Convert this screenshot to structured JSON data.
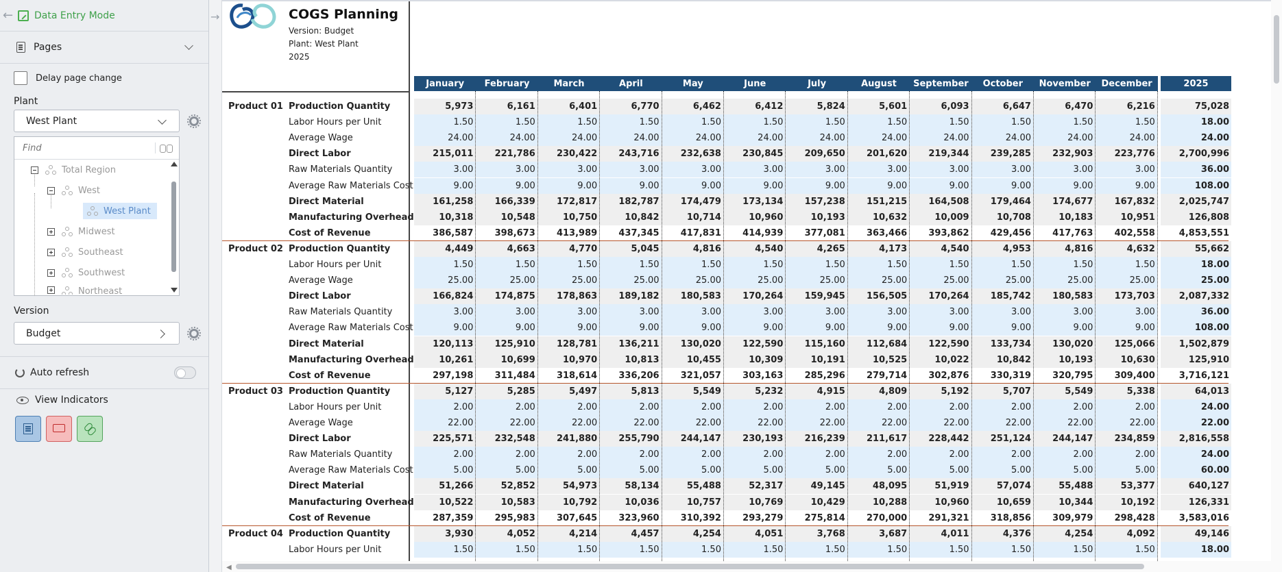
{
  "sidebar": {
    "mode_label": "Data Entry Mode",
    "pages_label": "Pages",
    "delay_label": "Delay page change",
    "plant_label": "Plant",
    "plant_value": "West Plant",
    "find_placeholder": "Find",
    "tree": [
      {
        "label": "Total Region",
        "expander": "minus"
      },
      {
        "label": "West",
        "expander": "minus"
      },
      {
        "label": "West Plant",
        "expander": "none",
        "selected": true
      },
      {
        "label": "Midwest",
        "expander": "plus"
      },
      {
        "label": "Southeast",
        "expander": "plus"
      },
      {
        "label": "Southwest",
        "expander": "plus"
      },
      {
        "label": "Northeast",
        "expander": "plus"
      }
    ],
    "version_label": "Version",
    "version_value": "Budget",
    "auto_refresh_label": "Auto refresh",
    "view_indicators_label": "View Indicators"
  },
  "report": {
    "title": "COGS Planning",
    "version_line": "Version: Budget",
    "plant_line": "Plant: West Plant",
    "year_line": "2025",
    "columns": [
      "January",
      "February",
      "March",
      "April",
      "May",
      "June",
      "July",
      "August",
      "September",
      "October",
      "November",
      "December"
    ],
    "total_column": "2025",
    "measures": [
      {
        "label": "Production Quantity",
        "bold": true
      },
      {
        "label": "Labor Hours per Unit",
        "bold": false
      },
      {
        "label": "Average Wage",
        "bold": false
      },
      {
        "label": "Direct Labor",
        "bold": true
      },
      {
        "label": "Raw Materials Quantity",
        "bold": false
      },
      {
        "label": "Average Raw Materials Cost",
        "bold": false
      },
      {
        "label": "Direct Material",
        "bold": true
      },
      {
        "label": "Manufacturing Overhead",
        "bold": true
      },
      {
        "label": "Cost of Revenue",
        "bold": true
      }
    ],
    "products": [
      {
        "name": "Product 01",
        "rows": [
          [
            "5,973",
            "6,161",
            "6,401",
            "6,770",
            "6,462",
            "6,412",
            "5,824",
            "5,601",
            "6,093",
            "6,647",
            "6,470",
            "6,216",
            "75,028"
          ],
          [
            "1.50",
            "1.50",
            "1.50",
            "1.50",
            "1.50",
            "1.50",
            "1.50",
            "1.50",
            "1.50",
            "1.50",
            "1.50",
            "1.50",
            "18.00"
          ],
          [
            "24.00",
            "24.00",
            "24.00",
            "24.00",
            "24.00",
            "24.00",
            "24.00",
            "24.00",
            "24.00",
            "24.00",
            "24.00",
            "24.00",
            "24.00"
          ],
          [
            "215,011",
            "221,786",
            "230,422",
            "243,716",
            "232,638",
            "230,845",
            "209,650",
            "201,620",
            "219,344",
            "239,285",
            "232,903",
            "223,776",
            "2,700,996"
          ],
          [
            "3.00",
            "3.00",
            "3.00",
            "3.00",
            "3.00",
            "3.00",
            "3.00",
            "3.00",
            "3.00",
            "3.00",
            "3.00",
            "3.00",
            "36.00"
          ],
          [
            "9.00",
            "9.00",
            "9.00",
            "9.00",
            "9.00",
            "9.00",
            "9.00",
            "9.00",
            "9.00",
            "9.00",
            "9.00",
            "9.00",
            "108.00"
          ],
          [
            "161,258",
            "166,339",
            "172,817",
            "182,787",
            "174,479",
            "173,134",
            "157,238",
            "151,215",
            "164,508",
            "179,464",
            "174,677",
            "167,832",
            "2,025,747"
          ],
          [
            "10,318",
            "10,548",
            "10,750",
            "10,842",
            "10,714",
            "10,960",
            "10,193",
            "10,632",
            "10,009",
            "10,708",
            "10,183",
            "10,951",
            "126,808"
          ],
          [
            "386,587",
            "398,673",
            "413,989",
            "437,345",
            "417,831",
            "414,939",
            "377,081",
            "363,466",
            "393,862",
            "429,456",
            "417,763",
            "402,558",
            "4,853,551"
          ]
        ]
      },
      {
        "name": "Product 02",
        "rows": [
          [
            "4,449",
            "4,663",
            "4,770",
            "5,045",
            "4,816",
            "4,540",
            "4,265",
            "4,173",
            "4,540",
            "4,953",
            "4,816",
            "4,632",
            "55,662"
          ],
          [
            "1.50",
            "1.50",
            "1.50",
            "1.50",
            "1.50",
            "1.50",
            "1.50",
            "1.50",
            "1.50",
            "1.50",
            "1.50",
            "1.50",
            "18.00"
          ],
          [
            "25.00",
            "25.00",
            "25.00",
            "25.00",
            "25.00",
            "25.00",
            "25.00",
            "25.00",
            "25.00",
            "25.00",
            "25.00",
            "25.00",
            "25.00"
          ],
          [
            "166,824",
            "174,875",
            "178,863",
            "189,182",
            "180,583",
            "170,264",
            "159,945",
            "156,505",
            "170,264",
            "185,742",
            "180,583",
            "173,703",
            "2,087,332"
          ],
          [
            "3.00",
            "3.00",
            "3.00",
            "3.00",
            "3.00",
            "3.00",
            "3.00",
            "3.00",
            "3.00",
            "3.00",
            "3.00",
            "3.00",
            "36.00"
          ],
          [
            "9.00",
            "9.00",
            "9.00",
            "9.00",
            "9.00",
            "9.00",
            "9.00",
            "9.00",
            "9.00",
            "9.00",
            "9.00",
            "9.00",
            "108.00"
          ],
          [
            "120,113",
            "125,910",
            "128,781",
            "136,211",
            "130,020",
            "122,590",
            "115,160",
            "112,684",
            "122,590",
            "133,734",
            "130,020",
            "125,066",
            "1,502,879"
          ],
          [
            "10,261",
            "10,699",
            "10,970",
            "10,813",
            "10,455",
            "10,309",
            "10,191",
            "10,525",
            "10,022",
            "10,842",
            "10,193",
            "10,630",
            "125,910"
          ],
          [
            "297,198",
            "311,484",
            "318,614",
            "336,206",
            "321,057",
            "303,163",
            "285,296",
            "279,714",
            "302,876",
            "330,319",
            "320,795",
            "309,400",
            "3,716,121"
          ]
        ]
      },
      {
        "name": "Product 03",
        "rows": [
          [
            "5,127",
            "5,285",
            "5,497",
            "5,813",
            "5,549",
            "5,232",
            "4,915",
            "4,809",
            "5,192",
            "5,707",
            "5,549",
            "5,338",
            "64,013"
          ],
          [
            "2.00",
            "2.00",
            "2.00",
            "2.00",
            "2.00",
            "2.00",
            "2.00",
            "2.00",
            "2.00",
            "2.00",
            "2.00",
            "2.00",
            "24.00"
          ],
          [
            "22.00",
            "22.00",
            "22.00",
            "22.00",
            "22.00",
            "22.00",
            "22.00",
            "22.00",
            "22.00",
            "22.00",
            "22.00",
            "22.00",
            "22.00"
          ],
          [
            "225,571",
            "232,548",
            "241,880",
            "255,790",
            "244,147",
            "230,193",
            "216,239",
            "211,617",
            "228,442",
            "251,124",
            "244,147",
            "234,859",
            "2,816,558"
          ],
          [
            "2.00",
            "2.00",
            "2.00",
            "2.00",
            "2.00",
            "2.00",
            "2.00",
            "2.00",
            "2.00",
            "2.00",
            "2.00",
            "2.00",
            "24.00"
          ],
          [
            "5.00",
            "5.00",
            "5.00",
            "5.00",
            "5.00",
            "5.00",
            "5.00",
            "5.00",
            "5.00",
            "5.00",
            "5.00",
            "5.00",
            "60.00"
          ],
          [
            "51,266",
            "52,852",
            "54,973",
            "58,134",
            "55,488",
            "52,317",
            "49,145",
            "48,095",
            "51,919",
            "57,074",
            "55,488",
            "53,377",
            "640,127"
          ],
          [
            "10,522",
            "10,583",
            "10,792",
            "10,036",
            "10,757",
            "10,769",
            "10,429",
            "10,288",
            "10,960",
            "10,659",
            "10,344",
            "10,192",
            "126,331"
          ],
          [
            "287,359",
            "295,983",
            "307,645",
            "323,960",
            "310,392",
            "293,279",
            "275,814",
            "270,000",
            "291,321",
            "318,856",
            "309,979",
            "298,428",
            "3,583,016"
          ]
        ]
      },
      {
        "name": "Product 04",
        "rows": [
          [
            "3,930",
            "4,052",
            "4,214",
            "4,457",
            "4,254",
            "4,051",
            "3,768",
            "3,687",
            "4,011",
            "4,376",
            "4,254",
            "4,092",
            "49,146"
          ],
          [
            "1.50",
            "1.50",
            "1.50",
            "1.50",
            "1.50",
            "1.50",
            "1.50",
            "1.50",
            "1.50",
            "1.50",
            "1.50",
            "1.50",
            "18.00"
          ]
        ]
      }
    ]
  },
  "colors": {
    "header_bg": "#1f4e79",
    "input_bg": "#e1effb",
    "calc_bg": "#efefef",
    "group_separator": "#b6552b",
    "mode_green": "#3fa04a"
  }
}
